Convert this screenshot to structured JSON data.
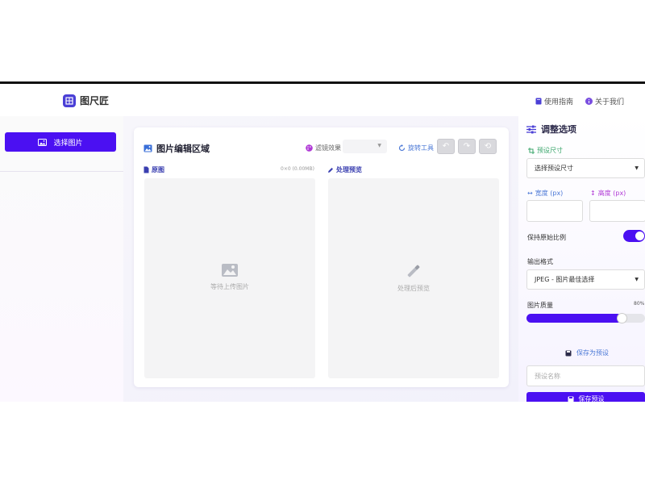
{
  "app": {
    "name": "图尺匠"
  },
  "header": {
    "guide_label": "使用指南",
    "about_label": "关于我们"
  },
  "sidebar": {
    "select_image_label": "选择图片"
  },
  "editor": {
    "title": "图片编辑区域",
    "filter_label": "滤镜效果",
    "filter_value": "",
    "rotate_label": "旋转工具",
    "original": {
      "label": "原图",
      "info": "0×0 (0.00MB)",
      "placeholder": "等待上传图片"
    },
    "preview": {
      "label": "处理预览",
      "placeholder": "处理后预览"
    }
  },
  "options": {
    "title": "调整选项",
    "preset_label": "预设尺寸",
    "preset_select": "选择预设尺寸",
    "width_label": "宽度 (px)",
    "height_label": "高度 (px)",
    "width_value": "",
    "height_value": "",
    "keep_ratio_label": "保持原始比例",
    "keep_ratio": true,
    "format_label": "输出格式",
    "format_value": "JPEG - 图片最佳选择",
    "quality_label": "图片质量",
    "quality_display": "80%",
    "quality_level": 0.8,
    "save_as_preset_label": "保存为预设",
    "preset_name_placeholder": "预设名称",
    "save_preset_button": "保存预设"
  },
  "colors": {
    "accent": "#4b10f2",
    "link": "#4b78d6",
    "green": "#3aa66b",
    "logo": "#4a3fd6"
  }
}
